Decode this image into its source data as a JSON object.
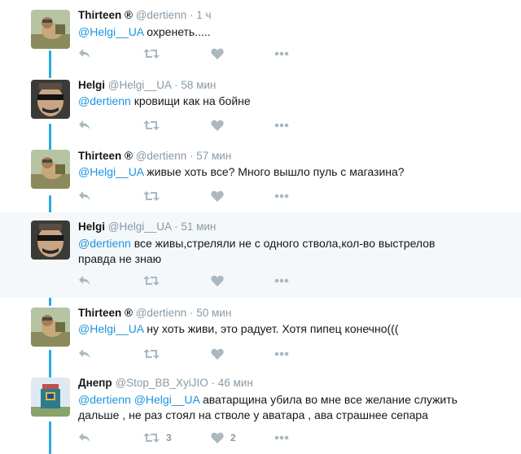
{
  "tweets": [
    {
      "name": "Thirteen ®",
      "handle": "@dertienn",
      "time": "1 ч",
      "parts": [
        {
          "t": "@Helgi__UA",
          "m": true
        },
        {
          "t": " охренеть.....",
          "m": false
        }
      ],
      "retweets": "",
      "likes": "",
      "avatar": "thirteen"
    },
    {
      "name": "Helgi",
      "handle": "@Helgi__UA",
      "time": "58 мин",
      "parts": [
        {
          "t": "@dertienn",
          "m": true
        },
        {
          "t": " кровищи как на бойне",
          "m": false
        }
      ],
      "retweets": "",
      "likes": "",
      "avatar": "helgi"
    },
    {
      "name": "Thirteen ®",
      "handle": "@dertienn",
      "time": "57 мин",
      "parts": [
        {
          "t": "@Helgi__UA",
          "m": true
        },
        {
          "t": " живые хоть все? Много вышло пуль с магазина?",
          "m": false
        }
      ],
      "retweets": "",
      "likes": "",
      "avatar": "thirteen"
    },
    {
      "name": "Helgi",
      "handle": "@Helgi__UA",
      "time": "51 мин",
      "parts": [
        {
          "t": "@dertienn",
          "m": true
        },
        {
          "t": " все живы,стреляли не с одного ствола,кол-во выстрелов правда не знаю",
          "m": false
        }
      ],
      "retweets": "",
      "likes": "",
      "avatar": "helgi"
    },
    {
      "name": "Thirteen ®",
      "handle": "@dertienn",
      "time": "50 мин",
      "parts": [
        {
          "t": "@Helgi__UA",
          "m": true
        },
        {
          "t": " ну хоть живи, это радует. Хотя пипец конечно(((",
          "m": false
        }
      ],
      "retweets": "",
      "likes": "",
      "avatar": "thirteen"
    },
    {
      "name": "Днепр",
      "handle": "@Stop_BB_XyiJIO",
      "time": "46 мин",
      "parts": [
        {
          "t": "@dertienn",
          "m": true
        },
        {
          "t": " ",
          "m": false
        },
        {
          "t": "@Helgi__UA",
          "m": true
        },
        {
          "t": " аватарщина убила во мне все желание служить дальше , не раз стоял на стволе у аватара , ава страшнее сепара",
          "m": false
        }
      ],
      "retweets": "3",
      "likes": "2",
      "avatar": "dnepr"
    }
  ],
  "separator": "·",
  "colors": {
    "mention": "#1b95e0",
    "connector": "#2aa9e0",
    "icon": "#aab8c2",
    "highlight_bg": "#f5f8fa"
  },
  "icons": [
    "reply-icon",
    "retweet-icon",
    "like-icon",
    "more-icon"
  ]
}
